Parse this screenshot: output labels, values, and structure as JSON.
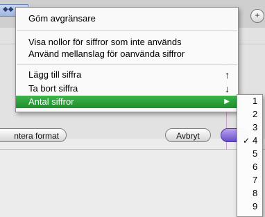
{
  "background": {
    "left_button_label": "ntera format",
    "cancel_button_label": "Avbryt",
    "add_symbol": "+"
  },
  "menu": {
    "items": [
      {
        "label": "Göm avgränsare",
        "shortcut": ""
      },
      {
        "label": "Visa nollor för siffror som inte används",
        "shortcut": ""
      },
      {
        "label": "Använd mellanslag för oanvända siffror",
        "shortcut": ""
      },
      {
        "label": "Lägg till siffra",
        "shortcut": "↑"
      },
      {
        "label": "Ta bort siffra",
        "shortcut": "↓"
      },
      {
        "label": "Antal siffror",
        "shortcut": "▶",
        "highlighted": true
      }
    ]
  },
  "submenu": {
    "checked_value": "4",
    "check_mark": "✓",
    "options": [
      "1",
      "2",
      "3",
      "4",
      "5",
      "6",
      "7",
      "8",
      "9"
    ]
  },
  "colors": {
    "highlight": "#2aa53a",
    "ok_button": "#7b5fd6"
  }
}
